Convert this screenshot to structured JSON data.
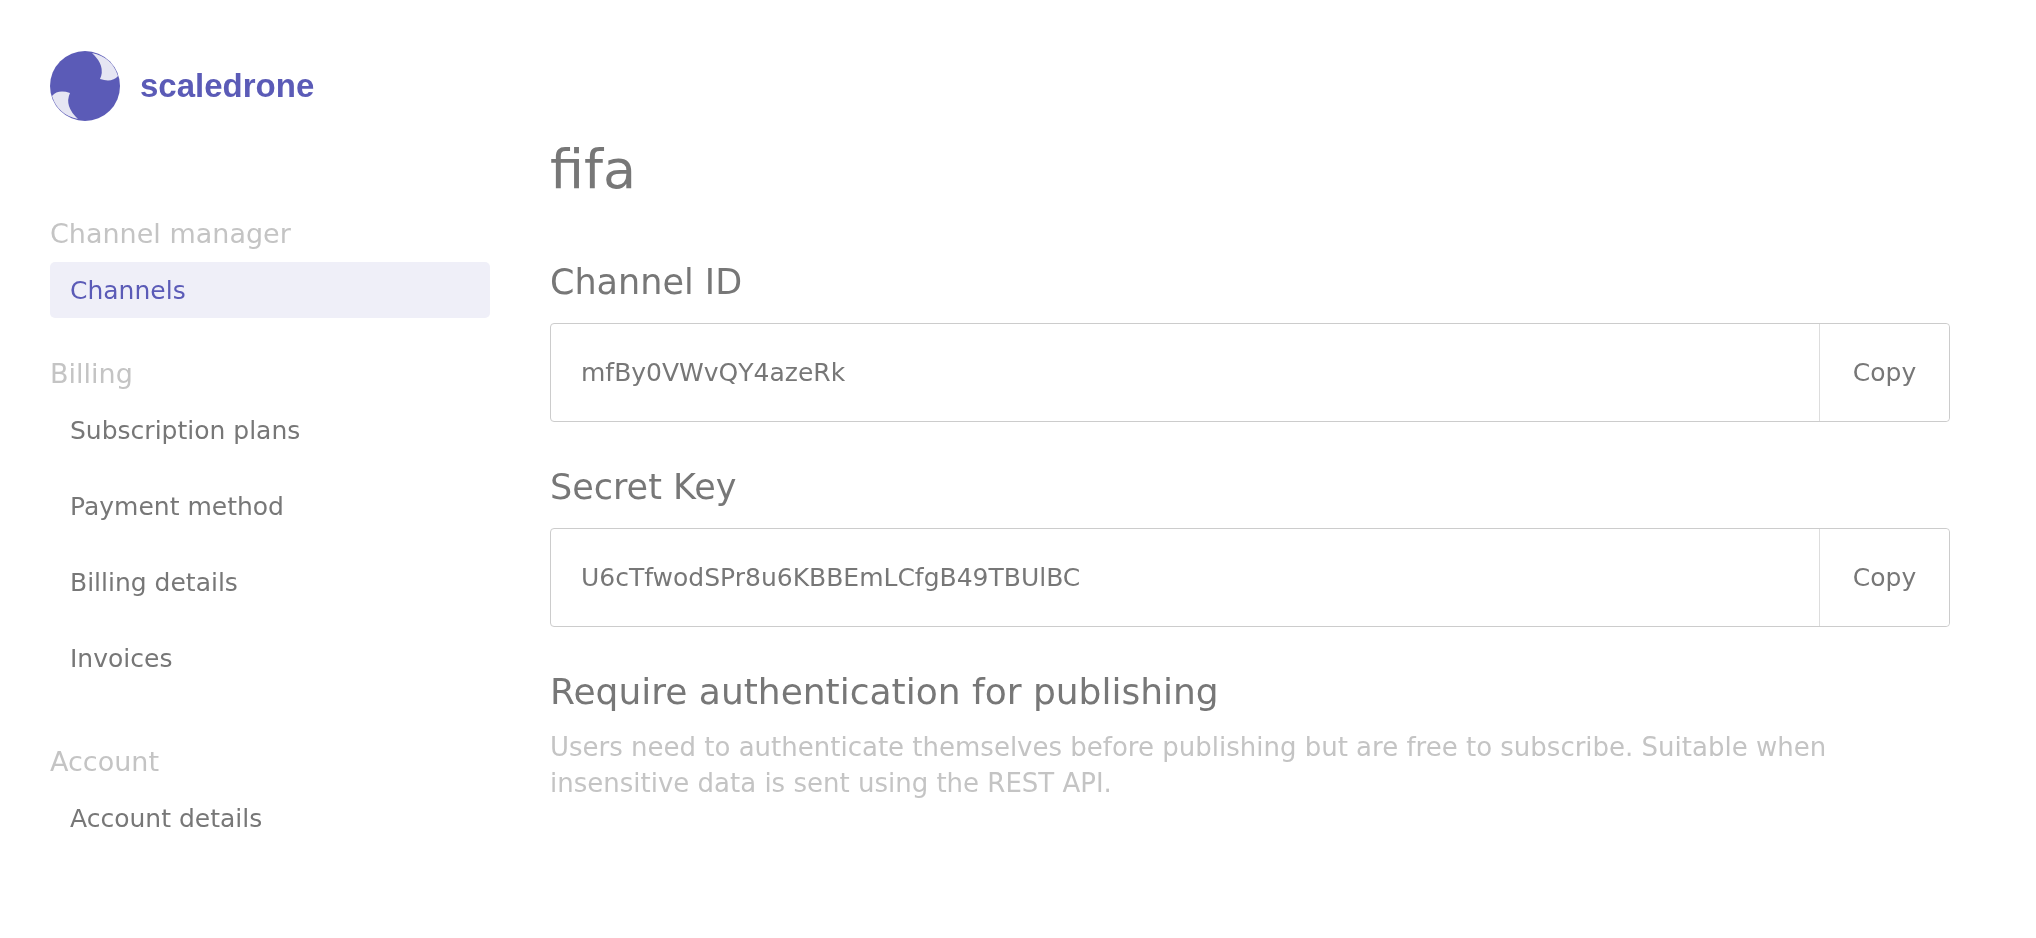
{
  "logo": {
    "text": "scaledrone"
  },
  "sidebar": {
    "sections": [
      {
        "heading": "Channel manager",
        "items": [
          {
            "label": "Channels",
            "selected": true
          }
        ]
      },
      {
        "heading": "Billing",
        "items": [
          {
            "label": "Subscription plans",
            "selected": false
          },
          {
            "label": "Payment method",
            "selected": false
          },
          {
            "label": "Billing details",
            "selected": false
          },
          {
            "label": "Invoices",
            "selected": false
          }
        ]
      },
      {
        "heading": "Account",
        "items": [
          {
            "label": "Account details",
            "selected": false
          }
        ]
      }
    ]
  },
  "main": {
    "title": "fifa",
    "fields": [
      {
        "label": "Channel ID",
        "value": "mfBy0VWvQY4azeRk",
        "button": "Copy"
      },
      {
        "label": "Secret Key",
        "value": "U6cTfwodSPr8u6KBBEmLCfgB49TBUlBC",
        "button": "Copy"
      }
    ],
    "setting": {
      "heading": "Require authentication for publishing",
      "description": "Users need to authenticate themselves before publishing but are free to subscribe. Suitable when insensitive data is sent using the REST API."
    }
  }
}
